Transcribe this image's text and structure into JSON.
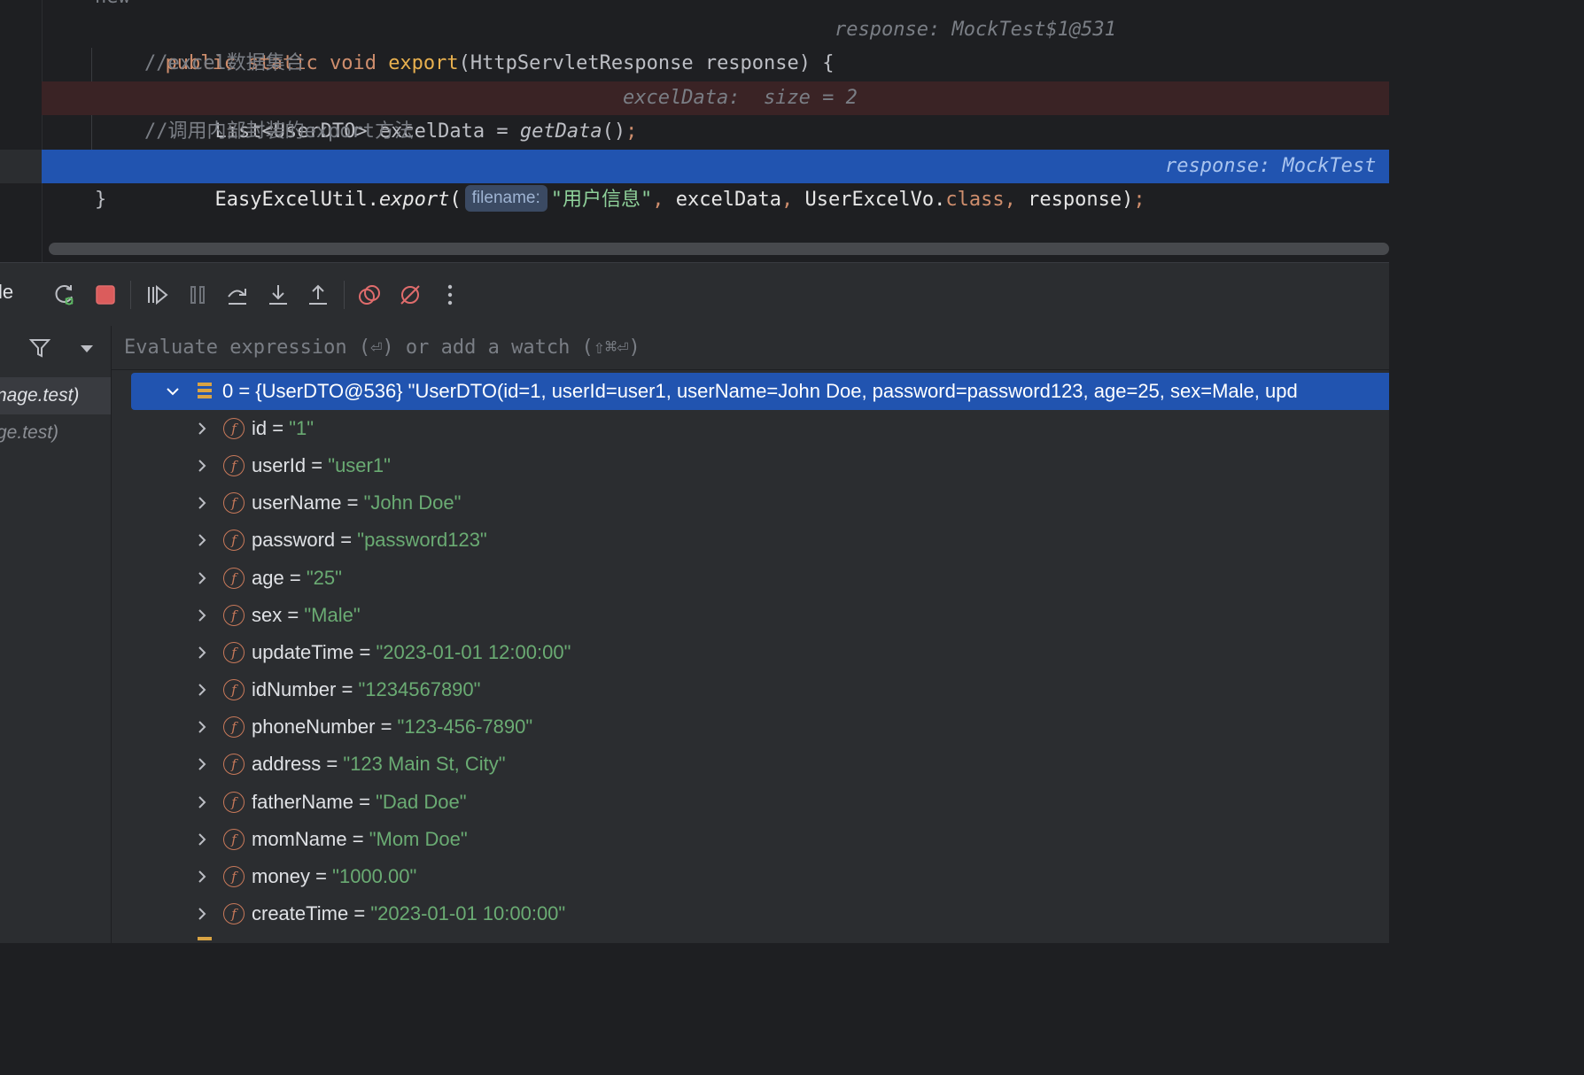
{
  "editor": {
    "line_top_fragment": "new",
    "line1": {
      "kw_public": "public",
      "kw_static": "static",
      "kw_void": "void",
      "method": "export",
      "params": "(HttpServletResponse response) {",
      "hint": "response: MockTest$1@531"
    },
    "line2": {
      "comment": "//excel数据集合"
    },
    "line3": {
      "code_a": "List<UserDTO> excelData = ",
      "call": "getData",
      "code_b": "()",
      "semi": ";",
      "hint": "excelData:  size = 2"
    },
    "line4": {
      "comment": "//调用内部封装的export方法"
    },
    "line5": {
      "code_a": "EasyExcelUtil.",
      "method": "export",
      "open": "(",
      "param_hint": "filename:",
      "str": "\"用户信息\"",
      "comma1": ",",
      "arg2": " excelData",
      "comma2": ",",
      "arg3": " UserExcelVo.",
      "kw_class": "class",
      "comma3": ",",
      "arg4": " response)",
      "semi": ";",
      "hint": "response: MockTest"
    },
    "line6": {
      "code": "}"
    }
  },
  "toolbar": {
    "left_fragment": "le",
    "buttons": [
      "rerun-debug-icon",
      "stop-icon",
      "resume-icon",
      "pause-icon",
      "step-over-icon",
      "step-into-icon",
      "step-out-icon",
      "view-breakpoints-icon",
      "mute-breakpoints-icon",
      "more-icon"
    ]
  },
  "frames": {
    "items": [
      {
        "label": "nage.test)"
      },
      {
        "label": "ge.test)"
      }
    ]
  },
  "evaluate": {
    "placeholder": "Evaluate expression (⏎) or add a watch (⇧⌘⏎)"
  },
  "variables": {
    "root": {
      "text": "0 = {UserDTO@536} \"UserDTO(id=1, userId=user1, userName=John Doe, password=password123, age=25, sex=Male, upd"
    },
    "fields": [
      {
        "name": "id",
        "value": "\"1\""
      },
      {
        "name": "userId",
        "value": "\"user1\""
      },
      {
        "name": "userName",
        "value": "\"John Doe\""
      },
      {
        "name": "password",
        "value": "\"password123\""
      },
      {
        "name": "age",
        "value": "\"25\""
      },
      {
        "name": "sex",
        "value": "\"Male\""
      },
      {
        "name": "updateTime",
        "value": "\"2023-01-01 12:00:00\""
      },
      {
        "name": "idNumber",
        "value": "\"1234567890\""
      },
      {
        "name": "phoneNumber",
        "value": "\"123-456-7890\""
      },
      {
        "name": "address",
        "value": "\"123 Main St, City\""
      },
      {
        "name": "fatherName",
        "value": "\"Dad Doe\""
      },
      {
        "name": "momName",
        "value": "\"Mom Doe\""
      },
      {
        "name": "money",
        "value": "\"1000.00\""
      },
      {
        "name": "createTime",
        "value": "\"2023-01-01 10:00:00\""
      }
    ],
    "field_icon_glyph": "f",
    "equals": "="
  },
  "colors": {
    "editor_bg": "#1e1f22",
    "panel_bg": "#2b2d30",
    "selection": "#2154b0",
    "breakpoint_line": "#3a2325",
    "keyword": "#cf8e6d",
    "string": "#6aab73",
    "comment": "#7a7e85"
  }
}
